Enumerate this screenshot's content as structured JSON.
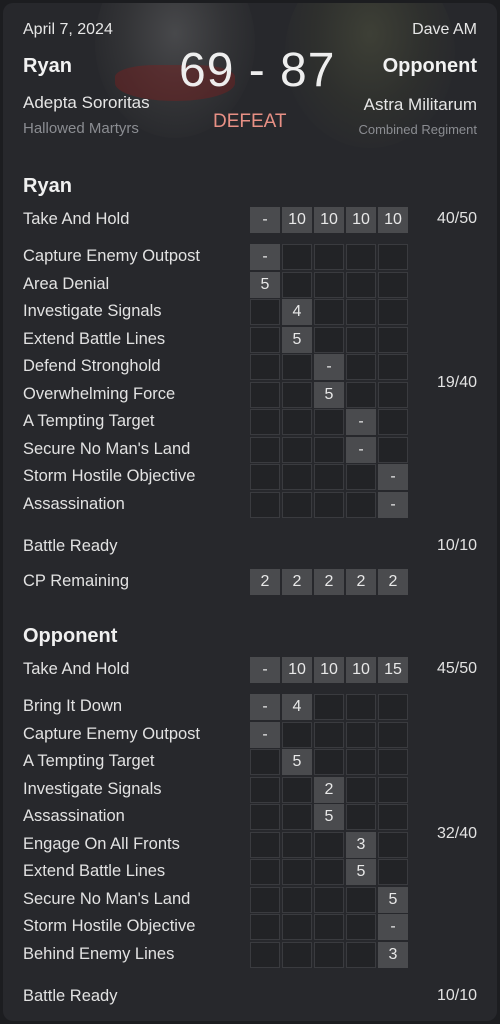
{
  "header": {
    "date": "April 7, 2024",
    "mode": "Dave AM",
    "player_left": {
      "name": "Ryan",
      "faction": "Adepta Sororitas",
      "detachment": "Hallowed Martyrs"
    },
    "player_right": {
      "name": "Opponent",
      "faction": "Astra Militarum",
      "detachment": "Combined Regiment"
    },
    "score": "69 - 87",
    "result": "DEFEAT",
    "result_color": "#e89085"
  },
  "sections": [
    {
      "title": "Ryan",
      "take_and_hold": {
        "label": "Take And Hold",
        "rounds": [
          "-",
          "10",
          "10",
          "10",
          "10"
        ],
        "total": "40/50"
      },
      "secondaries": [
        {
          "label": "Capture Enemy Outpost",
          "round": 0,
          "value": "-"
        },
        {
          "label": "Area Denial",
          "round": 0,
          "value": "5"
        },
        {
          "label": "Investigate Signals",
          "round": 1,
          "value": "4"
        },
        {
          "label": "Extend Battle Lines",
          "round": 1,
          "value": "5"
        },
        {
          "label": "Defend Stronghold",
          "round": 2,
          "value": "-"
        },
        {
          "label": "Overwhelming Force",
          "round": 2,
          "value": "5"
        },
        {
          "label": "A Tempting Target",
          "round": 3,
          "value": "-"
        },
        {
          "label": "Secure No Man's Land",
          "round": 3,
          "value": "-"
        },
        {
          "label": "Storm Hostile Objective",
          "round": 4,
          "value": "-"
        },
        {
          "label": "Assassination",
          "round": 4,
          "value": "-"
        }
      ],
      "secondary_total": "19/40",
      "battle_ready": {
        "label": "Battle Ready",
        "total": "10/10"
      },
      "cp_remaining": {
        "label": "CP Remaining",
        "rounds": [
          "2",
          "2",
          "2",
          "2",
          "2"
        ]
      }
    },
    {
      "title": "Opponent",
      "take_and_hold": {
        "label": "Take And Hold",
        "rounds": [
          "-",
          "10",
          "10",
          "10",
          "15"
        ],
        "total": "45/50"
      },
      "secondaries": [
        {
          "label": "Bring It Down",
          "cells": [
            {
              "round": 0,
              "value": "-"
            },
            {
              "round": 1,
              "value": "4"
            }
          ]
        },
        {
          "label": "Capture Enemy Outpost",
          "cells": [
            {
              "round": 0,
              "value": "-"
            }
          ]
        },
        {
          "label": "A Tempting Target",
          "cells": [
            {
              "round": 1,
              "value": "5"
            }
          ]
        },
        {
          "label": "Investigate Signals",
          "cells": [
            {
              "round": 2,
              "value": "2"
            }
          ]
        },
        {
          "label": "Assassination",
          "cells": [
            {
              "round": 2,
              "value": "5"
            }
          ]
        },
        {
          "label": "Engage On All Fronts",
          "cells": [
            {
              "round": 3,
              "value": "3"
            }
          ]
        },
        {
          "label": "Extend Battle Lines",
          "cells": [
            {
              "round": 3,
              "value": "5"
            }
          ]
        },
        {
          "label": "Secure No Man's Land",
          "cells": [
            {
              "round": 4,
              "value": "5"
            }
          ]
        },
        {
          "label": "Storm Hostile Objective",
          "cells": [
            {
              "round": 4,
              "value": "-"
            }
          ]
        },
        {
          "label": "Behind Enemy Lines",
          "cells": [
            {
              "round": 4,
              "value": "3"
            }
          ]
        }
      ],
      "secondary_total": "32/40",
      "battle_ready": {
        "label": "Battle Ready",
        "total": "10/10"
      }
    }
  ]
}
